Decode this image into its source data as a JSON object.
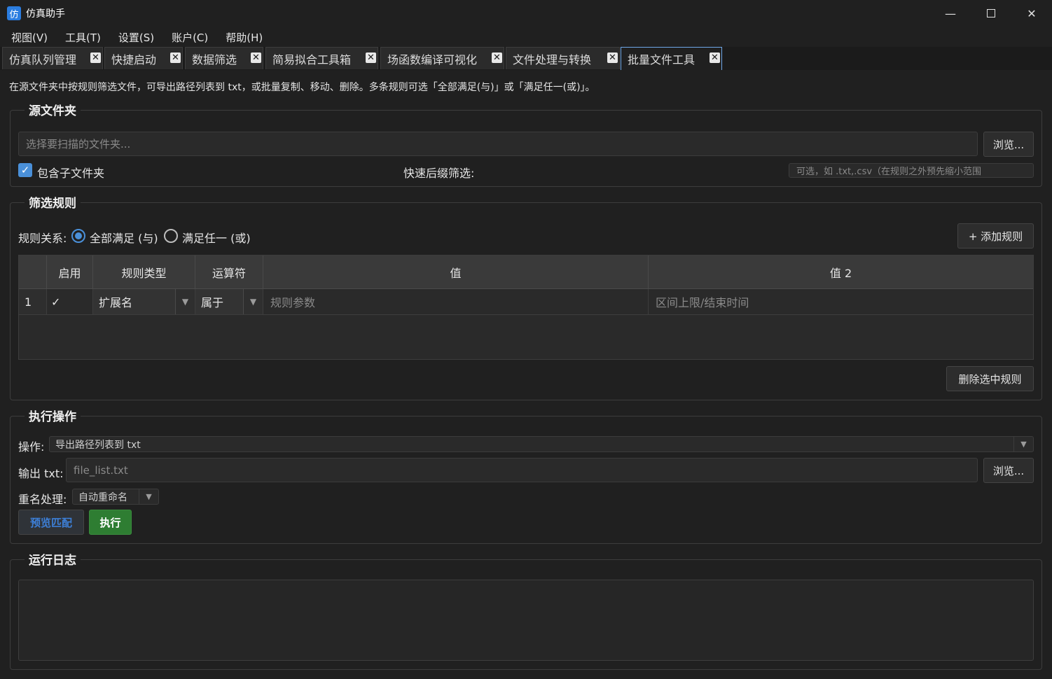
{
  "window": {
    "title": "仿真助手",
    "icon_text": "仿"
  },
  "menu": [
    "视图(V)",
    "工具(T)",
    "设置(S)",
    "账户(C)",
    "帮助(H)"
  ],
  "tabs": [
    {
      "label": "仿真队列管理",
      "active": false
    },
    {
      "label": "快捷启动",
      "active": false
    },
    {
      "label": "数据筛选",
      "active": false
    },
    {
      "label": "简易拟合工具箱",
      "active": false
    },
    {
      "label": "场函数编译可视化",
      "active": false
    },
    {
      "label": "文件处理与转换",
      "active": false
    },
    {
      "label": "批量文件工具",
      "active": true
    }
  ],
  "description": "在源文件夹中按规则筛选文件，可导出路径列表到 txt，或批量复制、移动、删除。多条规则可选「全部满足(与)」或「满足任一(或)」。",
  "source": {
    "title": "源文件夹",
    "folder_placeholder": "选择要扫描的文件夹...",
    "browse_label": "浏览...",
    "include_sub_label": "包含子文件夹",
    "include_sub_checked": true,
    "suffix_label": "快速后缀筛选:",
    "suffix_placeholder": "可选，如 .txt,.csv（在规则之外预先缩小范围"
  },
  "rules": {
    "title": "筛选规则",
    "relation_label": "规则关系:",
    "option_all": "全部满足 (与)",
    "option_any": "满足任一 (或)",
    "selected": "all",
    "add_label": "+ 添加规则",
    "delete_label": "删除选中规则",
    "headers": [
      "启用",
      "规则类型",
      "运算符",
      "值",
      "值 2"
    ],
    "rows": [
      {
        "index": "1",
        "enabled": "✓",
        "type": "扩展名",
        "operator": "属于",
        "value_placeholder": "规则参数",
        "value2_placeholder": "区间上限/结束时间"
      }
    ]
  },
  "exec": {
    "title": "执行操作",
    "operation_label": "操作:",
    "operation_value": "导出路径列表到 txt",
    "output_label": "输出 txt:",
    "output_placeholder": "file_list.txt",
    "browse_label": "浏览...",
    "rename_label": "重名处理:",
    "rename_value": "自动重命名",
    "preview_label": "预览匹配",
    "run_label": "执行",
    "preview_color": "#3d7fd6",
    "run_color": "#2e7d32"
  },
  "log": {
    "title": "运行日志"
  }
}
